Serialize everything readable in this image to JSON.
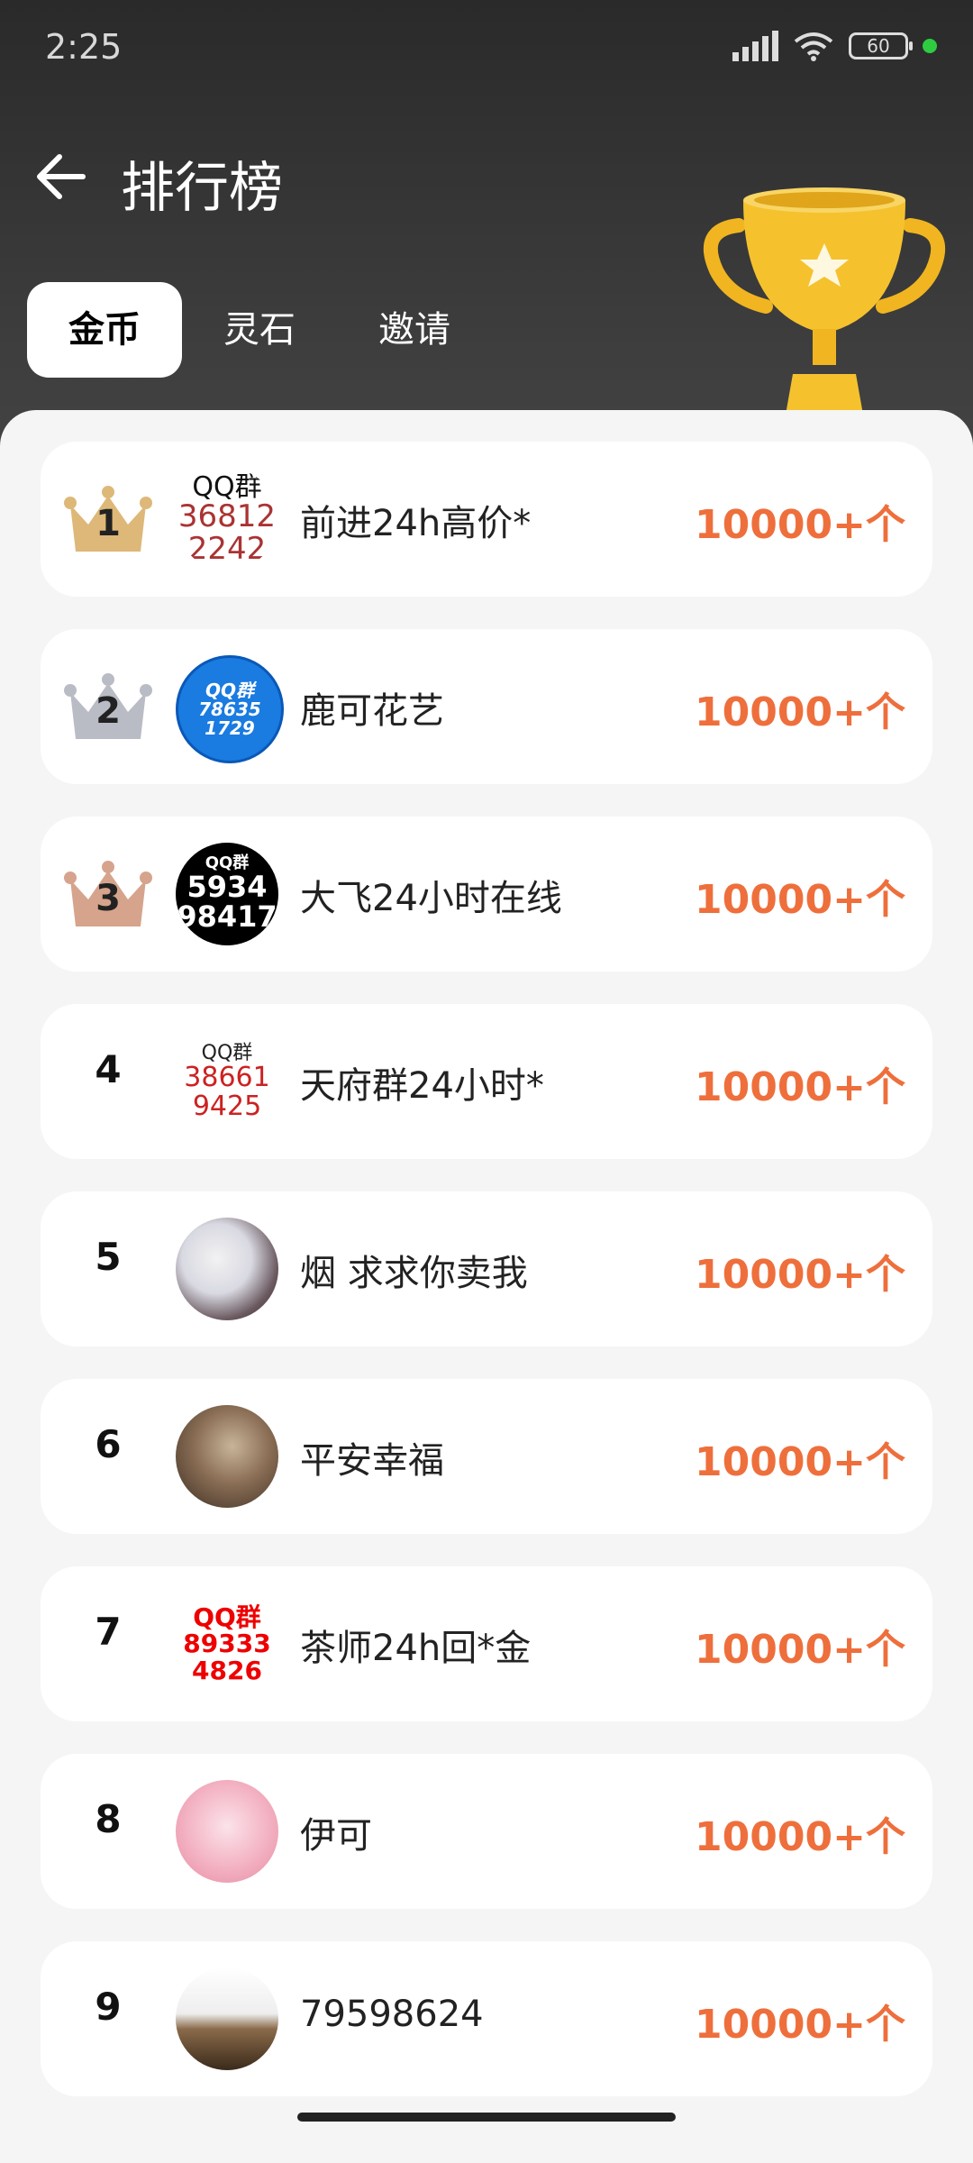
{
  "status_bar": {
    "time": "2:25",
    "battery": "60"
  },
  "header": {
    "title": "排行榜"
  },
  "tabs": [
    {
      "label": "金币",
      "active": true
    },
    {
      "label": "灵石",
      "active": false
    },
    {
      "label": "邀请",
      "active": false
    }
  ],
  "colors": {
    "accent": "#ee6f3c",
    "gold": "#ddb878",
    "silver": "#b9bcc5",
    "bronze": "#d6a48c"
  },
  "ranking": [
    {
      "rank": "1",
      "name": "前进24h高价*",
      "count": "10000+个",
      "avatar_lines": [
        "QQ群",
        "36812",
        "2242"
      ]
    },
    {
      "rank": "2",
      "name": "鹿可花艺",
      "count": "10000+个",
      "avatar_lines": [
        "QQ群",
        "78635",
        "1729"
      ]
    },
    {
      "rank": "3",
      "name": "大飞24小时在线",
      "count": "10000+个",
      "avatar_lines": [
        "QQ群",
        "5934",
        "98417"
      ]
    },
    {
      "rank": "4",
      "name": "天府群24小时*",
      "count": "10000+个",
      "avatar_lines": [
        "QQ群",
        "38661",
        "9425"
      ]
    },
    {
      "rank": "5",
      "name": "烟 求求你卖我",
      "count": "10000+个"
    },
    {
      "rank": "6",
      "name": "平安幸福",
      "count": "10000+个"
    },
    {
      "rank": "7",
      "name": "茶师24h回*金",
      "count": "10000+个",
      "avatar_lines": [
        "QQ群",
        "89333",
        "4826"
      ]
    },
    {
      "rank": "8",
      "name": "伊可",
      "count": "10000+个"
    },
    {
      "rank": "9",
      "name": "79598624",
      "count": "10000+个"
    }
  ]
}
